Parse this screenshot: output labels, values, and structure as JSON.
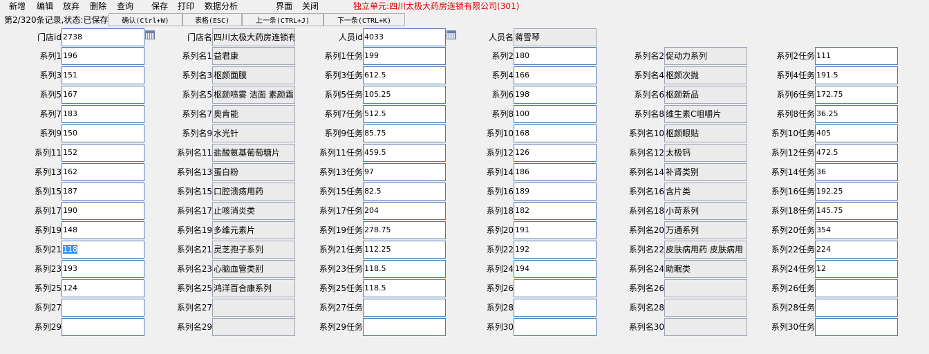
{
  "menu": [
    "新增",
    "编辑",
    "放弃",
    "删除",
    "查询",
    "保存",
    "打印",
    "数据分析",
    "界面",
    "关闭"
  ],
  "unit_title": "独立单元:四川太极大药房连锁有限公司(301)",
  "status_text": "第2/320条记录,状态:已保存",
  "toolbar": {
    "confirm": "确认(Ctrl+W)",
    "table": "表格(ESC)",
    "prev": "上一条(CTRL+J)",
    "next": "下一条(CTRL+K)"
  },
  "header": {
    "store_id_label": "门店id",
    "store_id": "2738",
    "store_name_label": "门店名",
    "store_name": "四川太极大药房连锁有",
    "staff_id_label": "人员id",
    "staff_id": "4033",
    "staff_name_label": "人员名",
    "staff_name": "蒋雪琴"
  },
  "series_label": "系列",
  "series_name_label": "系列名",
  "task_label": "任务",
  "series": [
    {
      "n": 1,
      "value": "196",
      "name": "益君康",
      "task": "199"
    },
    {
      "n": 2,
      "value": "180",
      "name": "促动力系列",
      "task": "111"
    },
    {
      "n": 3,
      "value": "151",
      "name": "枢颜面膜",
      "task": "612.5"
    },
    {
      "n": 4,
      "value": "166",
      "name": "枢颜次抛",
      "task": "191.5"
    },
    {
      "n": 5,
      "value": "167",
      "name": "枢颜喷雾 洁面 素颜霜",
      "task": "105.25"
    },
    {
      "n": 6,
      "value": "198",
      "name": "枢颜新品",
      "task": "172.75"
    },
    {
      "n": 7,
      "value": "183",
      "name": "奥肯能",
      "task": "512.5"
    },
    {
      "n": 8,
      "value": "100",
      "name": "维生素C咀嚼片",
      "task": "36.25"
    },
    {
      "n": 9,
      "value": "150",
      "name": "水光针",
      "task": "85.75"
    },
    {
      "n": 10,
      "value": "168",
      "name": "枢颜眼贴",
      "task": "405"
    },
    {
      "n": 11,
      "value": "152",
      "name": "盐酸氨基葡萄糖片",
      "task": "459.5"
    },
    {
      "n": 12,
      "value": "126",
      "name": "太极钙",
      "task": "472.5"
    },
    {
      "n": 13,
      "value": "162",
      "name": "蛋白粉",
      "task": "97"
    },
    {
      "n": 14,
      "value": "186",
      "name": "补肾类别",
      "task": "36"
    },
    {
      "n": 15,
      "value": "187",
      "name": "口腔溃疡用药",
      "task": "82.5"
    },
    {
      "n": 16,
      "value": "189",
      "name": "含片类",
      "task": "192.25"
    },
    {
      "n": 17,
      "value": "190",
      "name": "止咳消炎类",
      "task": "204"
    },
    {
      "n": 18,
      "value": "182",
      "name": "小苛系列",
      "task": "145.75"
    },
    {
      "n": 19,
      "value": "148",
      "name": "多维元素片",
      "task": "278.75"
    },
    {
      "n": 20,
      "value": "191",
      "name": "万通系列",
      "task": "354"
    },
    {
      "n": 21,
      "value": "118",
      "name": "灵芝孢子系列",
      "task": "112.25",
      "selected": true
    },
    {
      "n": 22,
      "value": "192",
      "name": "皮肤病用药  皮肤病用",
      "task": "224"
    },
    {
      "n": 23,
      "value": "193",
      "name": "心脑血管类别",
      "task": "118.5"
    },
    {
      "n": 24,
      "value": "194",
      "name": "助眠类",
      "task": "12"
    },
    {
      "n": 25,
      "value": "124",
      "name": "鸿洋百合康系列",
      "task": "118.5"
    },
    {
      "n": 26,
      "value": "",
      "name": "",
      "task": ""
    },
    {
      "n": 27,
      "value": "",
      "name": "",
      "task": ""
    },
    {
      "n": 28,
      "value": "",
      "name": "",
      "task": ""
    },
    {
      "n": 29,
      "value": "",
      "name": "",
      "task": ""
    },
    {
      "n": 30,
      "value": "",
      "name": "",
      "task": ""
    }
  ]
}
